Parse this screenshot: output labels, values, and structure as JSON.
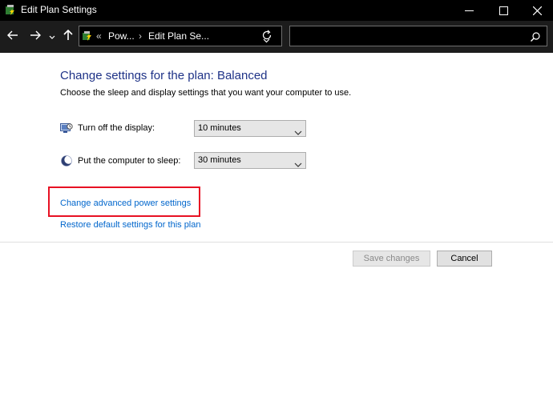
{
  "window": {
    "title": "Edit Plan Settings"
  },
  "titlebar_buttons": [
    "minimize-icon",
    "maximize-icon",
    "close-icon"
  ],
  "nav": {
    "buttons": [
      "back-arrow-icon",
      "forward-arrow-icon",
      "chevron-down-icon",
      "up-arrow-icon"
    ],
    "breadcrumb_overflow": "«",
    "crumbs": [
      "Pow...",
      "Edit Plan Se..."
    ],
    "separator": "›",
    "search_placeholder": ""
  },
  "main": {
    "heading": "Change settings for the plan: Balanced",
    "subtitle": "Choose the sleep and display settings that you want your computer to use.",
    "display": {
      "label": "Turn off the display:",
      "value": "10 minutes"
    },
    "sleep": {
      "label": "Put the computer to sleep:",
      "value": "30 minutes"
    },
    "advanced_link": "Change advanced power settings",
    "restore_link": "Restore default settings for this plan"
  },
  "buttons": {
    "save": "Save changes",
    "cancel": "Cancel"
  },
  "colors": {
    "heading": "#1e3287",
    "link": "#0066cc",
    "highlight": "#e81123"
  }
}
